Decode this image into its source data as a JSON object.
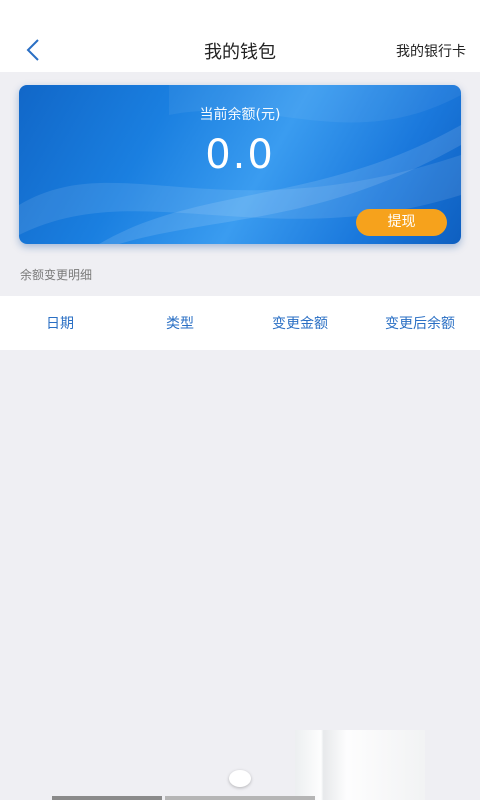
{
  "header": {
    "back_icon": "chevron-left-icon",
    "title": "我的钱包",
    "right_link": "我的银行卡"
  },
  "balance": {
    "label": "当前余额(元)",
    "amount": "0.0",
    "withdraw_label": "提现",
    "card_color": "#1a7fe0",
    "button_color": "#f6a21c"
  },
  "details": {
    "section_label": "余额变更明细",
    "columns": [
      "日期",
      "类型",
      "变更金额",
      "变更后余额"
    ],
    "column_color": "#2a6fc4"
  }
}
